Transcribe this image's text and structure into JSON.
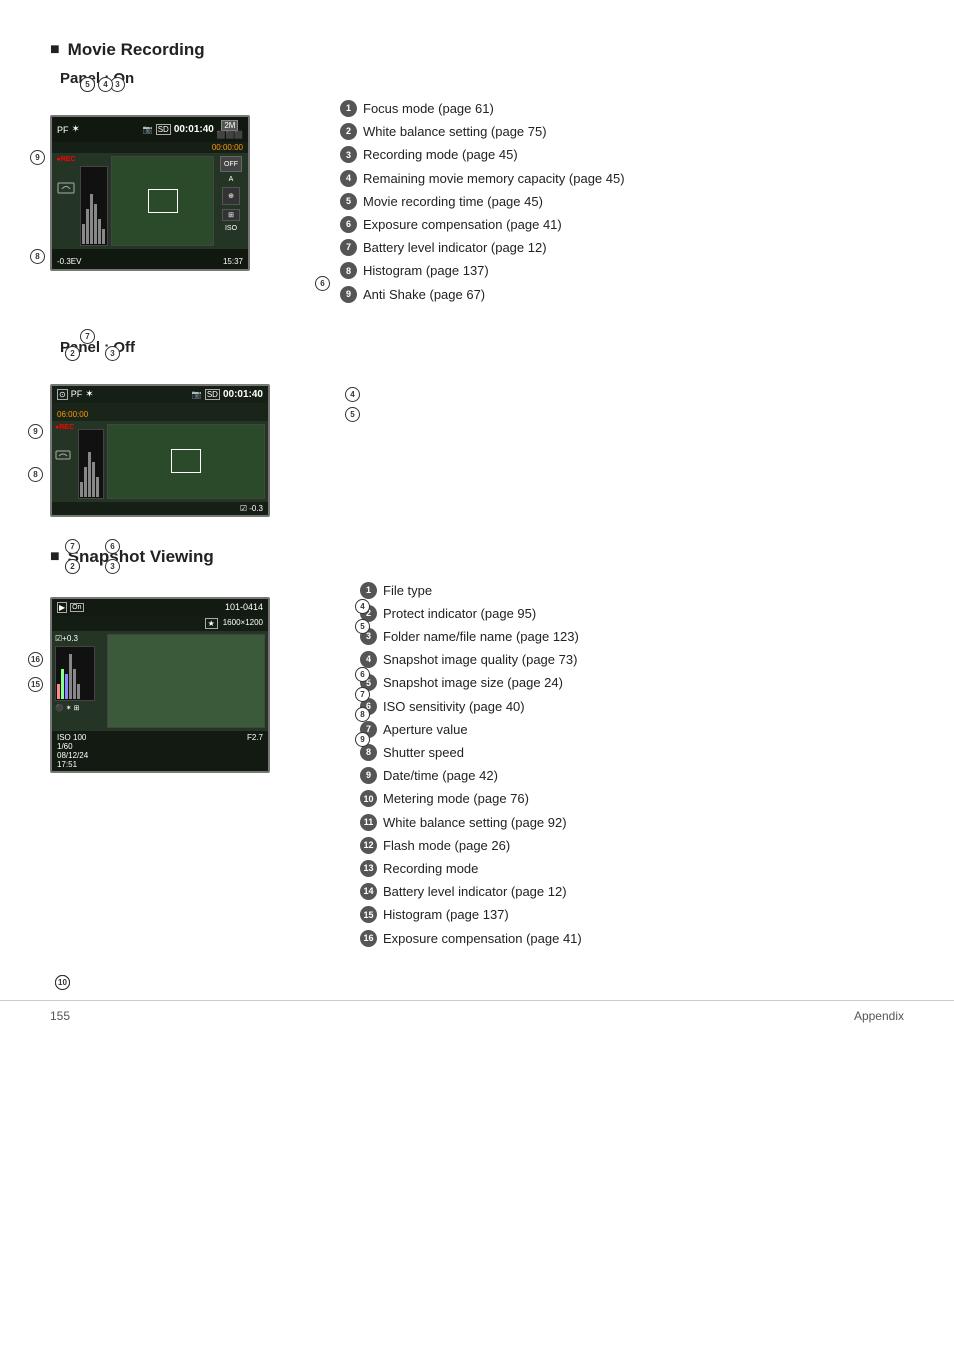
{
  "sections": {
    "movie_recording": {
      "title": "Movie Recording",
      "panel_on": {
        "label": "Panel : On",
        "legend": [
          {
            "num": "1",
            "text": "Focus mode (page 61)"
          },
          {
            "num": "2",
            "text": "White balance setting (page 75)"
          },
          {
            "num": "3",
            "text": "Recording mode (page 45)"
          },
          {
            "num": "4",
            "text": "Remaining movie memory capacity (page 45)"
          },
          {
            "num": "5",
            "text": "Movie recording time (page 45)"
          },
          {
            "num": "6",
            "text": "Exposure compensation (page 41)"
          },
          {
            "num": "7",
            "text": "Battery level indicator (page 12)"
          },
          {
            "num": "8",
            "text": "Histogram (page 137)"
          },
          {
            "num": "9",
            "text": "Anti Shake (page 67)"
          }
        ]
      },
      "panel_off": {
        "label": "Panel : Off"
      }
    },
    "snapshot_viewing": {
      "title": "Snapshot Viewing",
      "legend": [
        {
          "num": "1",
          "text": "File type"
        },
        {
          "num": "2",
          "text": "Protect indicator (page 95)"
        },
        {
          "num": "3",
          "text": "Folder name/file name (page 123)"
        },
        {
          "num": "4",
          "text": "Snapshot image quality (page 73)"
        },
        {
          "num": "5",
          "text": "Snapshot image size (page 24)"
        },
        {
          "num": "6",
          "text": "ISO sensitivity (page 40)"
        },
        {
          "num": "7",
          "text": "Aperture value"
        },
        {
          "num": "8",
          "text": "Shutter speed"
        },
        {
          "num": "9",
          "text": "Date/time (page 42)"
        },
        {
          "num": "10",
          "text": "Metering mode (page 76)"
        },
        {
          "num": "11",
          "text": "White balance setting (page 92)"
        },
        {
          "num": "12",
          "text": "Flash mode (page 26)"
        },
        {
          "num": "13",
          "text": "Recording mode"
        },
        {
          "num": "14",
          "text": "Battery level indicator (page 12)"
        },
        {
          "num": "15",
          "text": "Histogram (page 137)"
        },
        {
          "num": "16",
          "text": "Exposure compensation (page 41)"
        }
      ]
    }
  },
  "footer": {
    "page_number": "155",
    "label": "Appendix"
  },
  "screen_data": {
    "panel_on": {
      "pf": "PF",
      "star": "✶",
      "time": "00:01:40",
      "subtime": "00:00:00",
      "mode": "2M",
      "rec": "●REC",
      "iso": "ISO",
      "ev": "-0.3EV",
      "time_display": "15:37",
      "off_label": "OFF"
    },
    "panel_off": {
      "pf": "PF",
      "star": "✶",
      "time": "00:01:40",
      "subtime": "06:00:00",
      "rec": "●REC",
      "ev": "☑ -0.3"
    },
    "snapshot": {
      "folder": "101-0414",
      "size": "1600×1200",
      "iso": "ISO 100",
      "aperture": "F2.7",
      "shutter": "1/60",
      "date": "08/12/24",
      "time": "17:51",
      "ev": "☑+0.3"
    }
  }
}
